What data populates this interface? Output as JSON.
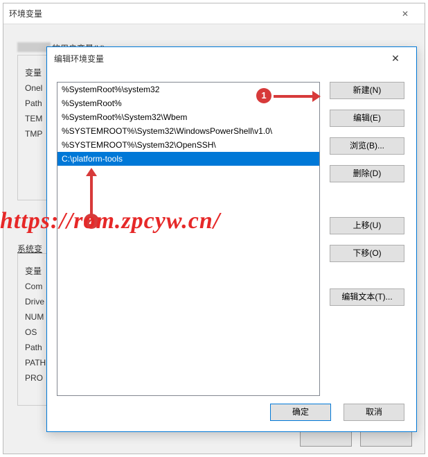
{
  "backWindow": {
    "title": "环境变量",
    "userVarLegend": "的用户变量(U)",
    "sysVarLegend": "系统变",
    "userVars": [
      "变量",
      "Onel",
      "Path",
      "TEM",
      "TMP"
    ],
    "sysVars": [
      "变量",
      "Com",
      "Drive",
      "NUM",
      "OS",
      "Path",
      "PATH",
      "PRO"
    ],
    "closeGlyph": "✕"
  },
  "frontWindow": {
    "title": "编辑环境变量",
    "closeGlyph": "✕",
    "listItems": [
      "%SystemRoot%\\system32",
      "%SystemRoot%",
      "%SystemRoot%\\System32\\Wbem",
      "%SYSTEMROOT%\\System32\\WindowsPowerShell\\v1.0\\",
      "%SYSTEMROOT%\\System32\\OpenSSH\\",
      "C:\\platform-tools"
    ],
    "selectedIndex": 5,
    "sideButtons": {
      "new": "新建(N)",
      "edit": "编辑(E)",
      "browse": "浏览(B)...",
      "delete": "删除(D)",
      "moveUp": "上移(U)",
      "moveDown": "下移(O)",
      "editText": "编辑文本(T)..."
    },
    "bottomButtons": {
      "ok": "确定",
      "cancel": "取消"
    }
  },
  "annotations": {
    "badge1": "1",
    "badge2": "2",
    "watermark": "https://rom.zpcyw.cn/"
  }
}
